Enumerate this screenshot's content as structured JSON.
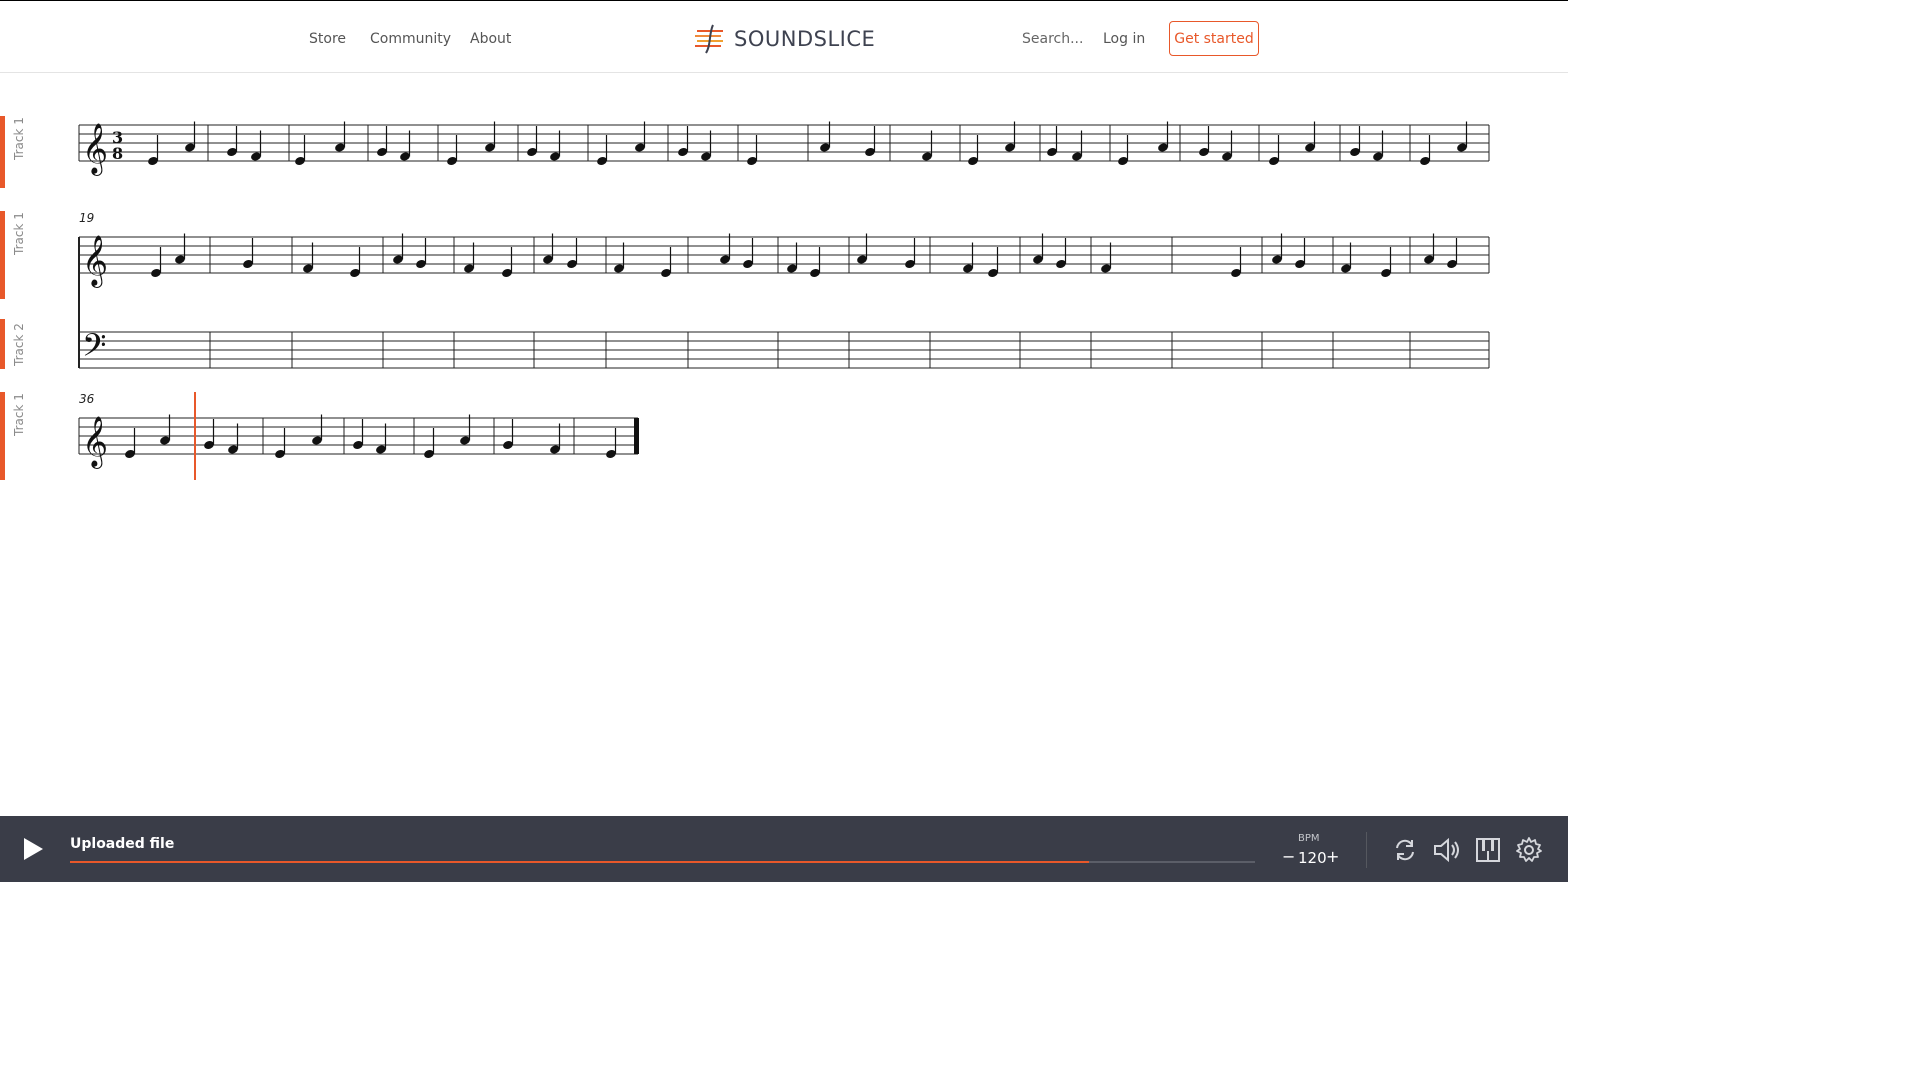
{
  "header": {
    "nav": [
      "Store",
      "Community",
      "About"
    ],
    "logo_text": "SOUNDSLICE",
    "search_label": "Search...",
    "login_label": "Log in",
    "cta_label": "Get started"
  },
  "score": {
    "systems": [
      {
        "tracks": [
          "Track 1"
        ],
        "measure_number": ""
      },
      {
        "tracks": [
          "Track 1",
          "Track 2"
        ],
        "measure_number": "19"
      },
      {
        "tracks": [
          "Track 1"
        ],
        "measure_number": "36"
      }
    ],
    "time_signature": "3/8"
  },
  "player": {
    "title": "Uploaded file",
    "progress": 0.86,
    "bpm_label": "BPM",
    "bpm_value": "120",
    "minus": "−",
    "plus": "+"
  },
  "colors": {
    "accent": "#e8582a",
    "player_bg": "#3a3d48"
  },
  "icons": [
    "play-icon",
    "loop-icon",
    "volume-icon",
    "piano-icon",
    "gear-icon"
  ]
}
